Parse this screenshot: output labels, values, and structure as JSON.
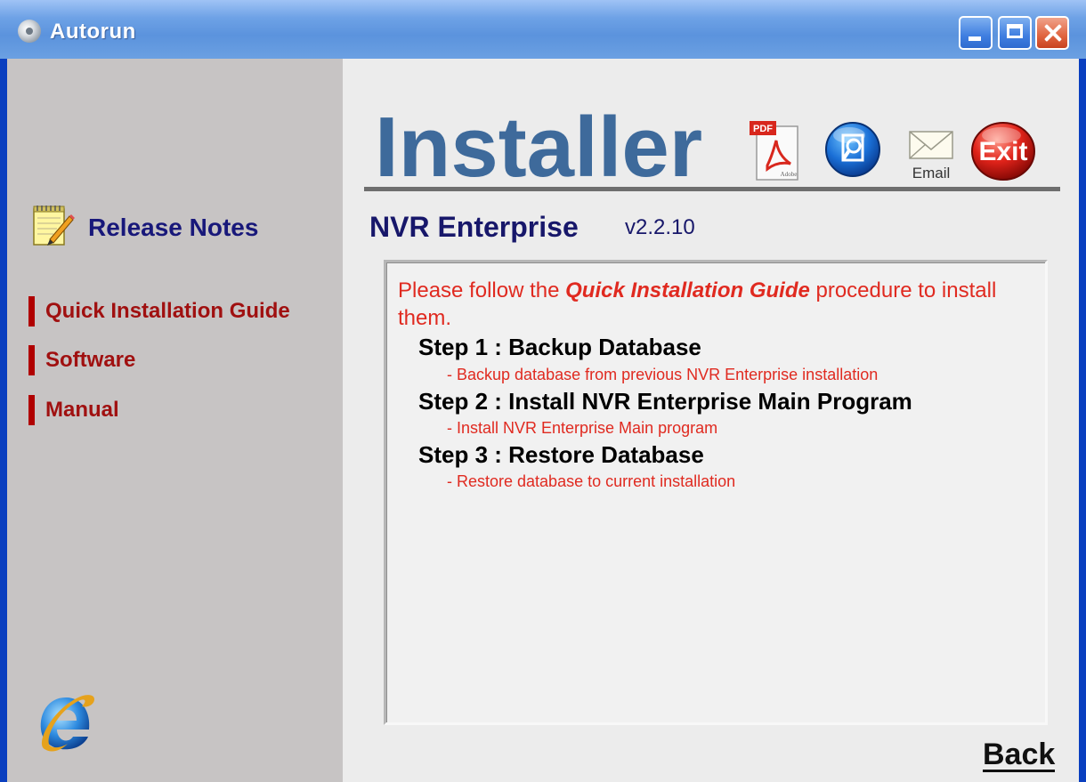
{
  "window": {
    "title": "Autorun",
    "controls": {
      "minimize": "minimize-icon",
      "maximize": "maximize-icon",
      "close": "close-icon"
    }
  },
  "sidebar": {
    "release_notes_label": "Release Notes",
    "nav_items": [
      {
        "label": "Quick Installation Guide"
      },
      {
        "label": "Software"
      },
      {
        "label": "Manual"
      }
    ],
    "browser_icon": "ie-icon"
  },
  "header": {
    "logo_text": "Installer",
    "actions": {
      "pdf_badge": "PDF",
      "pdf_caption": "Adobe",
      "email_caption": "Email",
      "exit_label": "Exit"
    }
  },
  "product": {
    "name": "NVR Enterprise",
    "version": "v2.2.10"
  },
  "guide": {
    "intro_prefix": "Please follow the ",
    "intro_emphasis": "Quick Installation Guide",
    "intro_suffix": " procedure to install them.",
    "steps": [
      {
        "title": "Step 1 : Backup Database",
        "description": "- Backup database from previous NVR Enterprise installation"
      },
      {
        "title": "Step 2 : Install NVR Enterprise Main Program",
        "description": "- Install NVR Enterprise Main program"
      },
      {
        "title": "Step 3 : Restore Database",
        "description": "- Restore database to current installation"
      }
    ]
  },
  "footer": {
    "back_label": "Back"
  },
  "colors": {
    "title_bar": "#6ea2e6",
    "sidebar_bg": "#c7c4c4",
    "nav_text": "#a01010",
    "heading_navy": "#17176a",
    "logo_blue": "#3e6a9b",
    "intro_red": "#e02a20"
  }
}
